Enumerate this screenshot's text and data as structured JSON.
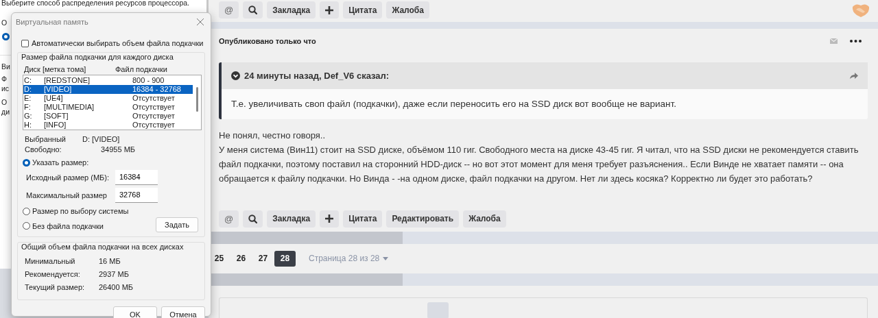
{
  "background_window": {
    "heading": "Выберите способ распределения ресурсов процессора.",
    "group_label": "О",
    "radio": {
      "selected": true
    },
    "section_label": "Ви",
    "paragraphs": [
      [
        "Ф",
        "ис"
      ],
      [
        "О",
        "ди"
      ]
    ]
  },
  "dialog": {
    "title": "Виртуальная память",
    "auto_checkbox": {
      "label": "Автоматически выбирать объем файла подкачки",
      "checked": false
    },
    "per_disk": {
      "legend": "Размер файла подкачки для каждого диска",
      "columns": [
        "Диск [метка тома]",
        "Файл подкачки"
      ],
      "drives": [
        {
          "letter": "C:",
          "label": "[REDSTONE]",
          "paging": "800 - 900",
          "selected": false
        },
        {
          "letter": "D:",
          "label": "[VIDEO]",
          "paging": "16384 - 32768",
          "selected": true
        },
        {
          "letter": "E:",
          "label": "[UE4]",
          "paging": "Отсутствует",
          "selected": false
        },
        {
          "letter": "F:",
          "label": "[MULTIMEDIA]",
          "paging": "Отсутствует",
          "selected": false
        },
        {
          "letter": "G:",
          "label": "[SOFT]",
          "paging": "Отсутствует",
          "selected": false
        },
        {
          "letter": "H:",
          "label": "[INFO]",
          "paging": "Отсутствует",
          "selected": false
        }
      ],
      "selected_label": "Выбранный",
      "selected_value": "D:  [VIDEO]",
      "free_label": "Свободно:",
      "free_value": "34955 МБ",
      "custom_size": {
        "label": "Указать размер:",
        "selected": true,
        "initial_label": "Исходный размер (МБ):",
        "initial_value": "16384",
        "max_label": "Максимальный размер",
        "max_value": "32768"
      },
      "system_size": {
        "label": "Размер по выбору системы",
        "selected": false
      },
      "no_file": {
        "label": "Без файла подкачки",
        "selected": false
      },
      "set_button": "Задать"
    },
    "totals": {
      "legend": "Общий объем файла подкачки на всех дисках",
      "rows": [
        {
          "label": "Минимальный",
          "value": "16 МБ"
        },
        {
          "label": "Рекомендуется:",
          "value": "2937 МБ"
        },
        {
          "label": "Текущий размер:",
          "value": "26400 МБ"
        }
      ]
    },
    "buttons": [
      "OK",
      "Отмена"
    ]
  },
  "forum": {
    "top_toolbar": [
      {
        "kind": "text",
        "label": "@"
      },
      {
        "kind": "search"
      },
      {
        "kind": "text",
        "label": "Закладка"
      },
      {
        "kind": "plus"
      },
      {
        "kind": "text",
        "label": "Цитата"
      },
      {
        "kind": "text",
        "label": "Жалоба"
      }
    ],
    "post": {
      "meta": "Опубликовано только что",
      "quote": {
        "header": "24 минуты назад, Def_V6 сказал:",
        "body": "Т.е. увеличивать своп файл (подкачки), даже если переносить его на SSD диск вот вообще не вариант."
      },
      "paragraphs": [
        "Не понял, честно говоря..",
        "У меня система (Вин11) стоит на SSD диске, объёмом 110 гиг.  Свободного места на диске 43-45 гиг. Я читал, что на SSD диски не рекомендуется ставить файл подкачки, поэтому поставил на сторонний HDD-диск -- но вот этот момент для меня требует разъяснения.. Если Винде не хватает памяти -- она обращается к файлу подкачки. Но Винда - -на одном диске, файл подкачки на другом. Нет ли здесь косяка?  Корректно ли будет это работать?"
      ],
      "actions": [
        {
          "kind": "text",
          "label": "@"
        },
        {
          "kind": "search"
        },
        {
          "kind": "text",
          "label": "Закладка"
        },
        {
          "kind": "plus"
        },
        {
          "kind": "text",
          "label": "Цитата"
        },
        {
          "kind": "text",
          "label": "Редактировать"
        },
        {
          "kind": "text",
          "label": "Жалоба"
        }
      ]
    },
    "pagination": {
      "pages": [
        {
          "label": "25",
          "selected": false
        },
        {
          "label": "26",
          "selected": false
        },
        {
          "label": "27",
          "selected": false
        },
        {
          "label": "28",
          "selected": true
        }
      ],
      "jump": "Страница 28 из 28"
    }
  }
}
